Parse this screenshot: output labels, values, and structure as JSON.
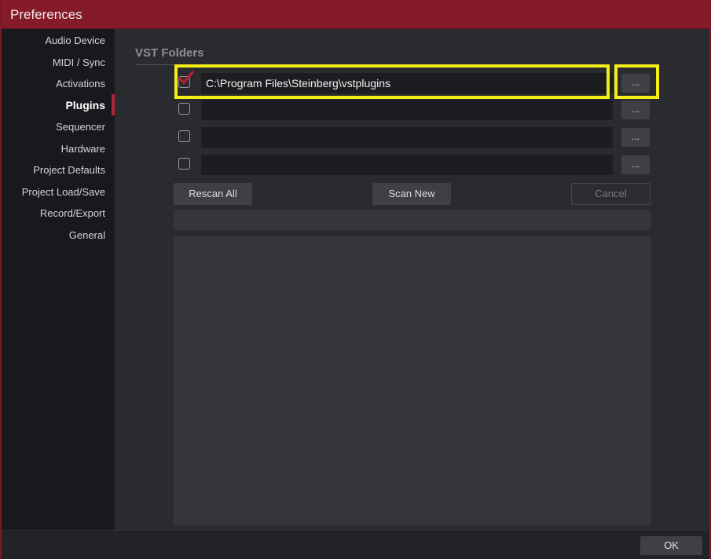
{
  "window": {
    "title": "Preferences"
  },
  "sidebar": {
    "items": [
      {
        "label": "Audio Device",
        "active": false
      },
      {
        "label": "MIDI / Sync",
        "active": false
      },
      {
        "label": "Activations",
        "active": false
      },
      {
        "label": "Plugins",
        "active": true
      },
      {
        "label": "Sequencer",
        "active": false
      },
      {
        "label": "Hardware",
        "active": false
      },
      {
        "label": "Project Defaults",
        "active": false
      },
      {
        "label": "Project Load/Save",
        "active": false
      },
      {
        "label": "Record/Export",
        "active": false
      },
      {
        "label": "General",
        "active": false
      }
    ]
  },
  "plugins": {
    "section_title": "VST Folders",
    "folders": [
      {
        "checked": true,
        "path": "C:\\Program Files\\Steinberg\\vstplugins",
        "browse_label": "..."
      },
      {
        "checked": false,
        "path": "",
        "browse_label": "..."
      },
      {
        "checked": false,
        "path": "",
        "browse_label": "..."
      },
      {
        "checked": false,
        "path": "",
        "browse_label": "..."
      }
    ],
    "rescan_all_label": "Rescan All",
    "scan_new_label": "Scan New",
    "cancel_label": "Cancel",
    "status_text": "",
    "log_text": ""
  },
  "footer": {
    "ok_label": "OK"
  },
  "colors": {
    "accent": "#851a28",
    "highlight": "#f5ee16",
    "check": "#b3202f"
  }
}
